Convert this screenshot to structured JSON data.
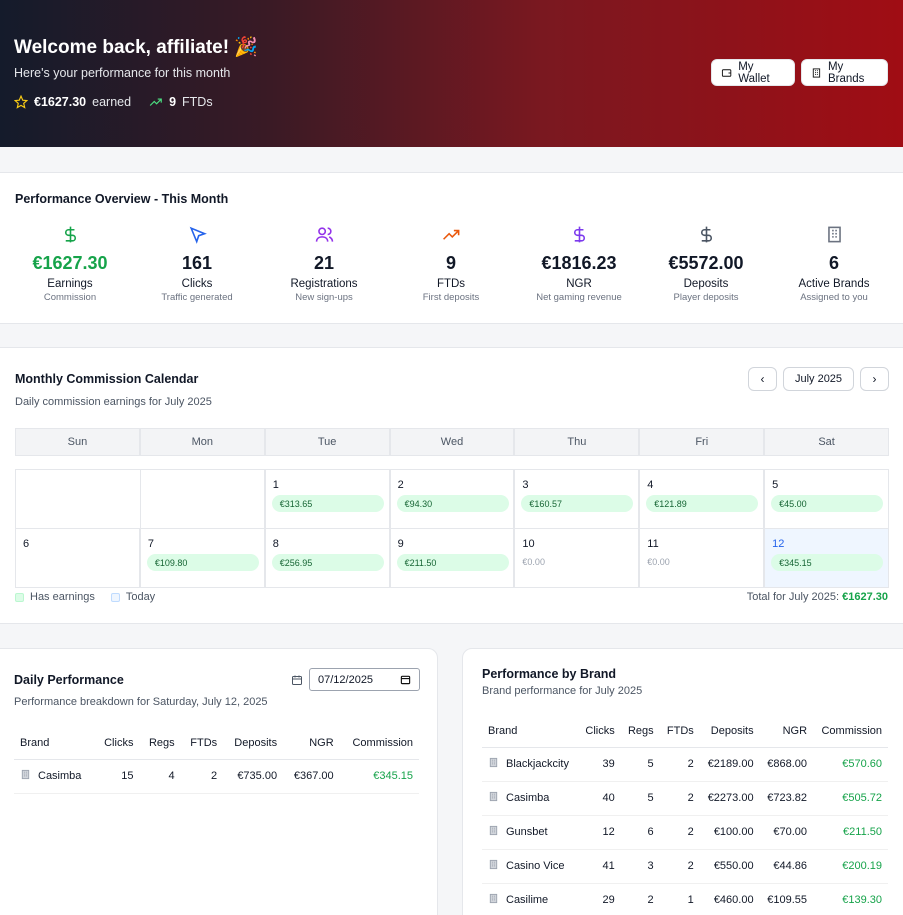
{
  "header": {
    "title": "Welcome back, affiliate! 🎉",
    "subtitle": "Here's your performance for this month",
    "earned_value": "€1627.30",
    "earned_label": "earned",
    "ftds_value": "9",
    "ftds_label": "FTDs",
    "wallet_button": "My Wallet",
    "brands_button": "My Brands"
  },
  "overview": {
    "title": "Performance Overview - This Month",
    "metrics": [
      {
        "icon": "dollar-icon",
        "value": "€1627.30",
        "label": "Earnings",
        "sub": "Commission",
        "color": "#16a34a"
      },
      {
        "icon": "cursor-icon",
        "value": "161",
        "label": "Clicks",
        "sub": "Traffic generated",
        "color": "#2563eb"
      },
      {
        "icon": "users-icon",
        "value": "21",
        "label": "Registrations",
        "sub": "New sign-ups",
        "color": "#9333ea"
      },
      {
        "icon": "trending-up-icon",
        "value": "9",
        "label": "FTDs",
        "sub": "First deposits",
        "color": "#ea580c"
      },
      {
        "icon": "dollar-icon",
        "value": "€1816.23",
        "label": "NGR",
        "sub": "Net gaming revenue",
        "color": "#7c3aed"
      },
      {
        "icon": "dollar-icon",
        "value": "€5572.00",
        "label": "Deposits",
        "sub": "Player deposits",
        "color": "#4b5563"
      },
      {
        "icon": "building-icon",
        "value": "6",
        "label": "Active Brands",
        "sub": "Assigned to you",
        "color": "#6b7280"
      }
    ]
  },
  "calendar": {
    "title": "Monthly Commission Calendar",
    "subtitle": "Daily commission earnings for July 2025",
    "month_label": "July 2025",
    "weekdays": [
      "Sun",
      "Mon",
      "Tue",
      "Wed",
      "Thu",
      "Fri",
      "Sat"
    ],
    "days": [
      {
        "day": "1",
        "amount": "€313.65",
        "earned": true
      },
      {
        "day": "2",
        "amount": "€94.30",
        "earned": true
      },
      {
        "day": "3",
        "amount": "€160.57",
        "earned": true
      },
      {
        "day": "4",
        "amount": "€121.89",
        "earned": true
      },
      {
        "day": "5",
        "amount": "€45.00",
        "earned": true
      },
      {
        "day": "6",
        "amount": "",
        "earned": false
      },
      {
        "day": "7",
        "amount": "€109.80",
        "earned": true
      },
      {
        "day": "8",
        "amount": "€256.95",
        "earned": true
      },
      {
        "day": "9",
        "amount": "€211.50",
        "earned": true
      },
      {
        "day": "10",
        "amount": "€0.00",
        "earned": false
      },
      {
        "day": "11",
        "amount": "€0.00",
        "earned": false
      },
      {
        "day": "12",
        "amount": "€345.15",
        "earned": true,
        "today": true
      }
    ],
    "legend_earnings": "Has earnings",
    "legend_today": "Today",
    "total_label": "Total for July 2025:",
    "total_value": "€1627.30",
    "colors": {
      "earn": "#dcfce7",
      "today": "#eff6ff"
    }
  },
  "daily": {
    "title": "Daily Performance",
    "subtitle": "Performance breakdown for Saturday, July 12, 2025",
    "date_value": "07/12/2025",
    "columns": [
      "Brand",
      "Clicks",
      "Regs",
      "FTDs",
      "Deposits",
      "NGR",
      "Commission"
    ],
    "rows": [
      [
        "Casimba",
        "15",
        "4",
        "2",
        "€735.00",
        "€367.00",
        "€345.15"
      ]
    ]
  },
  "by_brand": {
    "title": "Performance by Brand",
    "subtitle": "Brand performance for July 2025",
    "columns": [
      "Brand",
      "Clicks",
      "Regs",
      "FTDs",
      "Deposits",
      "NGR",
      "Commission"
    ],
    "rows": [
      [
        "Blackjackcity",
        "39",
        "5",
        "2",
        "€2189.00",
        "€868.00",
        "€570.60"
      ],
      [
        "Casimba",
        "40",
        "5",
        "2",
        "€2273.00",
        "€723.82",
        "€505.72"
      ],
      [
        "Gunsbet",
        "12",
        "6",
        "2",
        "€100.00",
        "€70.00",
        "€211.50"
      ],
      [
        "Casino Vice",
        "41",
        "3",
        "2",
        "€550.00",
        "€44.86",
        "€200.19"
      ],
      [
        "Casilime",
        "29",
        "2",
        "1",
        "€460.00",
        "€109.55",
        "€139.30"
      ]
    ]
  }
}
